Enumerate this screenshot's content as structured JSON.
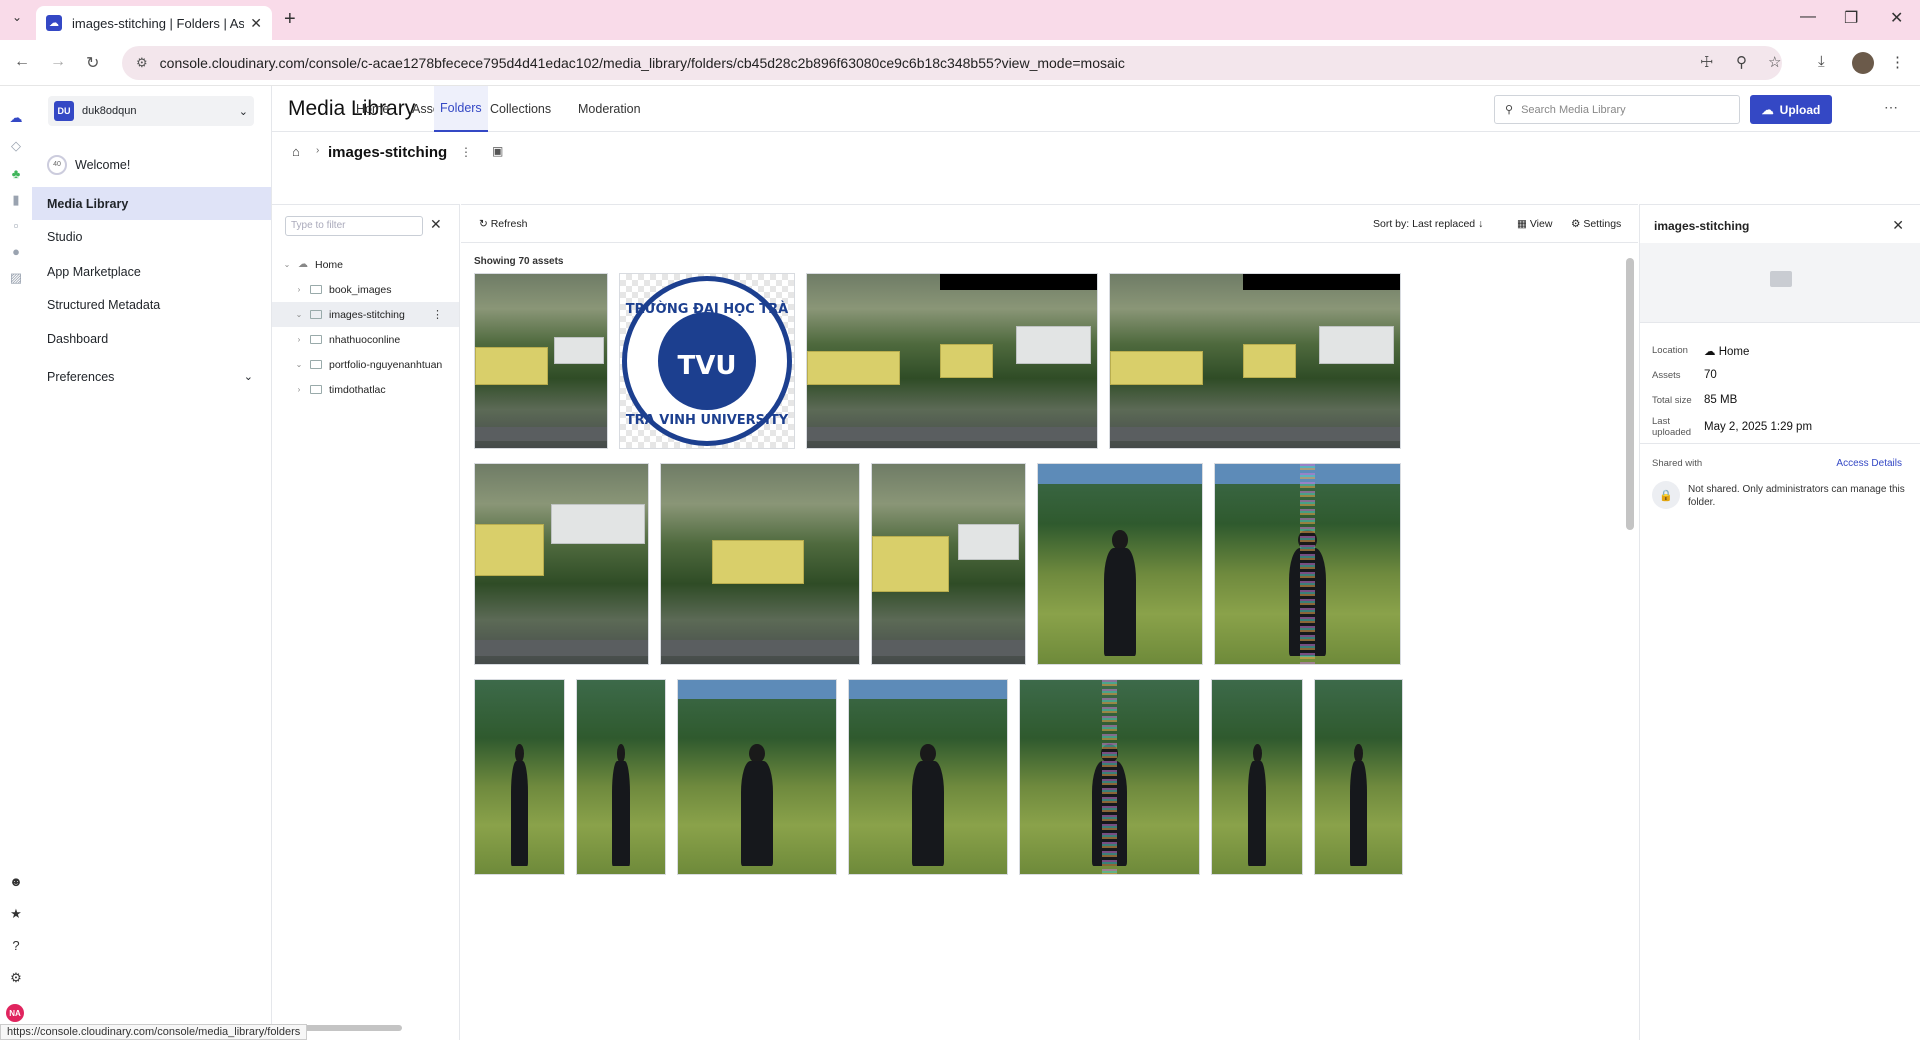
{
  "browser": {
    "tab_title": "images-stitching | Folders | Ass…",
    "url": "console.cloudinary.com/console/c-acae1278bfecece795d4d41edac102/media_library/folders/cb45d28c2b896f63080ce9c6b18c348b55?view_mode=mosaic",
    "status_url": "https://console.cloudinary.com/console/media_library/folders"
  },
  "account": {
    "badge": "DU",
    "name": "duk8odqun"
  },
  "user_badge": "NA",
  "leftnav": {
    "welcome": "Welcome!",
    "items": [
      "Media Library",
      "Studio",
      "App Marketplace",
      "Structured Metadata",
      "Dashboard",
      "Preferences"
    ]
  },
  "header": {
    "title": "Media Library",
    "tabs": [
      "Home",
      "Assets",
      "Folders",
      "Collections",
      "Moderation"
    ],
    "active_tab": "Folders",
    "search_placeholder": "Search Media Library",
    "upload_label": "Upload"
  },
  "breadcrumb": {
    "current": "images-stitching"
  },
  "tree": {
    "filter_placeholder": "Type to filter",
    "root": "Home",
    "folders": [
      "book_images",
      "images-stitching",
      "nhathuoconline",
      "portfolio-nguyenanhtuan",
      "timdothatlac"
    ],
    "active": "images-stitching"
  },
  "toolbar": {
    "refresh": "Refresh",
    "sort": "Sort by: Last replaced",
    "view": "View",
    "settings": "Settings"
  },
  "grid": {
    "showing": "Showing 70 assets",
    "logo_top_text": "TRƯỜNG ĐẠI HỌC TRÀ VINH",
    "logo_bottom_text": "TRA VINH UNIVERSITY",
    "logo_mark": "TVU"
  },
  "details": {
    "title": "images-stitching",
    "location_label": "Location",
    "location_value": "Home",
    "assets_label": "Assets",
    "assets_value": "70",
    "size_label": "Total size",
    "size_value": "85 MB",
    "last_label": "Last uploaded",
    "last_value": "May 2, 2025 1:29 pm",
    "shared_label": "Shared with",
    "access_details": "Access Details",
    "not_shared": "Not shared. Only administrators can manage this folder."
  },
  "colors": {
    "accent": "#3448c5",
    "tab_bar": "#f9dbe9",
    "active_nav": "#dfe3f7"
  }
}
